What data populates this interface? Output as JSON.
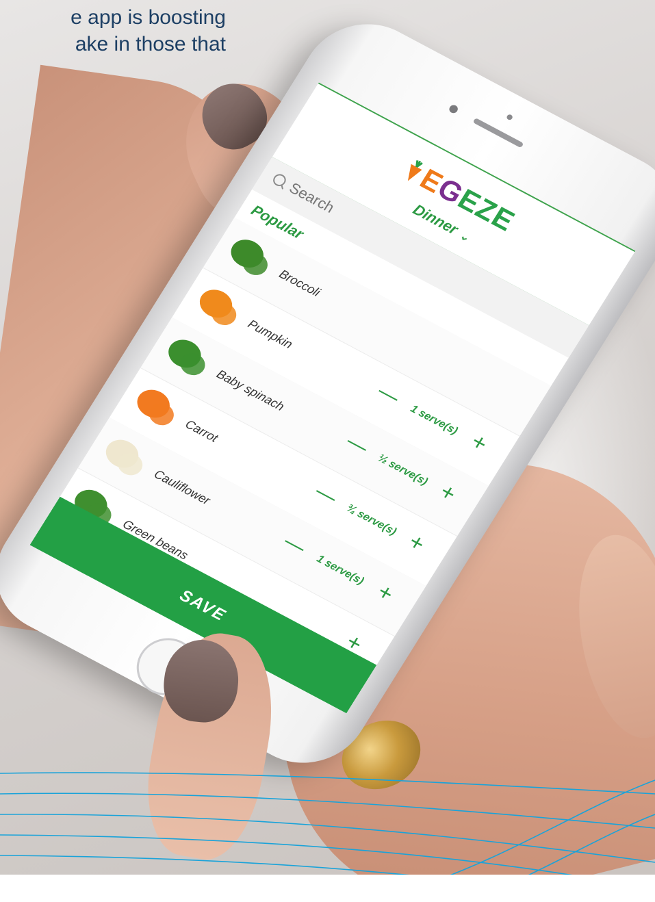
{
  "headline": {
    "line1": "e app is boosting",
    "line2": "ake in those that"
  },
  "app": {
    "logo": "EGEZE",
    "logo_icon": "carrot-icon",
    "meal": "Dinner",
    "meal_icon": "chevron-down-icon",
    "search_placeholder": "Search",
    "search_icon": "search-icon",
    "section_title": "Popular",
    "items": [
      {
        "name": "Broccoli",
        "serve": "",
        "has_minus": false
      },
      {
        "name": "Pumpkin",
        "serve": "1 serve(s)",
        "has_minus": true
      },
      {
        "name": "Baby spinach",
        "serve": "½ serve(s)",
        "has_minus": true
      },
      {
        "name": "Carrot",
        "serve": "¾ serve(s)",
        "has_minus": true
      },
      {
        "name": "Cauliflower",
        "serve": "1 serve(s)",
        "has_minus": true
      },
      {
        "name": "Green beans",
        "serve": "",
        "has_minus": false
      },
      {
        "name": "",
        "serve": "",
        "has_minus": false
      }
    ],
    "minus_symbol": "—",
    "plus_symbol": "+",
    "save_label": "SAVE"
  },
  "colors": {
    "app_green": "#23a045",
    "headline_navy": "#1d3f64",
    "wave_blue": "#1aa3d9"
  }
}
